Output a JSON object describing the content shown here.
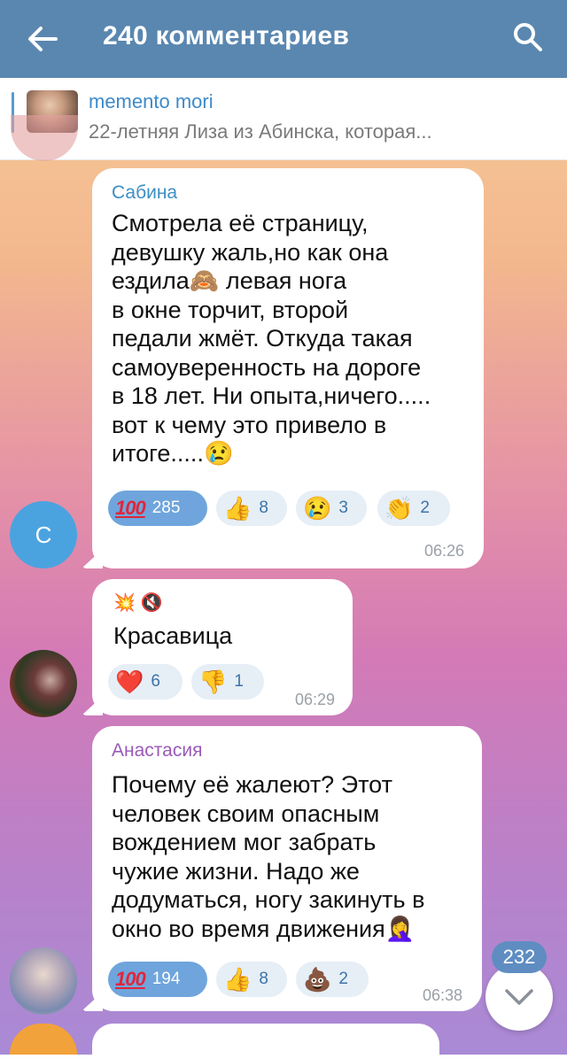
{
  "header": {
    "title": "240 комментариев",
    "back_icon": "arrow-left-icon",
    "search_icon": "search-icon"
  },
  "pinned": {
    "title": "memento mori",
    "text": "22-летняя Лиза из Абинска, которая..."
  },
  "messages": [
    {
      "author": "Сабина",
      "author_color": "#3d8ec4",
      "avatar_letter": "С",
      "lines": [
        "Смотрела её страницу,",
        "девушку жаль,но как она",
        "ездила🙈 левая нога",
        "в окне торчит, второй",
        "педали жмёт. Откуда такая",
        "самоуверенность на дороге",
        "в 18 лет. Ни опыта,ничего.....",
        "вот к чему это привело в",
        "итоге.....😢"
      ],
      "reactions": [
        {
          "emoji": "100",
          "count": "285",
          "active": true
        },
        {
          "emoji": "👍",
          "count": "8"
        },
        {
          "emoji": "😢",
          "count": "3"
        },
        {
          "emoji": "👏",
          "count": "2"
        }
      ],
      "time": "06:26"
    },
    {
      "author": "",
      "badge": "💥 🔇",
      "text": "Красавица",
      "reactions": [
        {
          "emoji": "❤️",
          "count": "6"
        },
        {
          "emoji": "👎",
          "count": "1"
        }
      ],
      "time": "06:29"
    },
    {
      "author": "Анастасия",
      "author_color": "#9a5ab8",
      "lines": [
        "Почему её жалеют? Этот",
        "человек своим опасным",
        "вождением мог забрать",
        "чужие жизни. Надо же",
        "додуматься, ногу закинуть в",
        "окно во время движения🤦‍♀️"
      ],
      "reactions": [
        {
          "emoji": "100",
          "count": "194",
          "active": true
        },
        {
          "emoji": "👍",
          "count": "8"
        },
        {
          "emoji": "💩",
          "count": "2"
        }
      ],
      "time": "06:38"
    }
  ],
  "scroll_badge": "232",
  "colors": {
    "header": "#5a87b0",
    "accent": "#3e8ac9",
    "reaction_active": "#6fa5dc"
  }
}
